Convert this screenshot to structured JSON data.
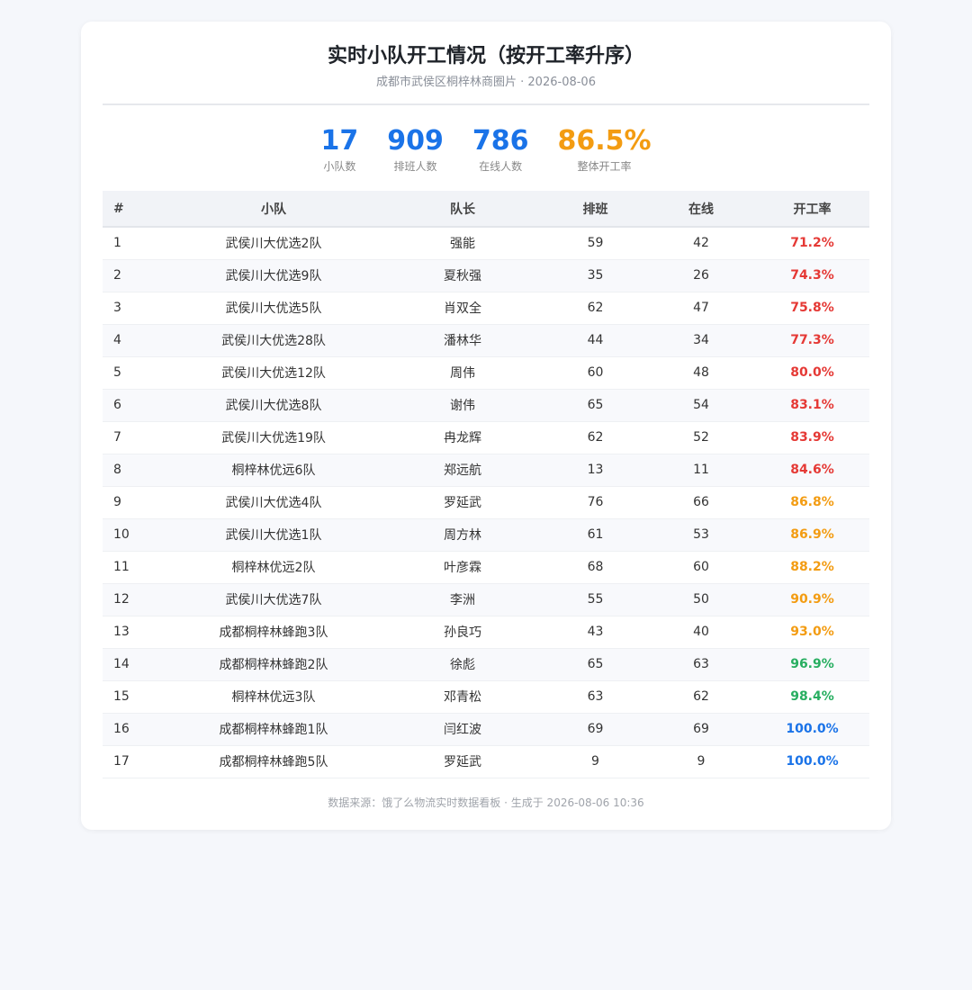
{
  "header": {
    "title": "实时小队开工情况（按开工率升序）",
    "subtitle": "成都市武侯区桐梓林商圈片 · 2026-08-06"
  },
  "stats": [
    {
      "value": "17",
      "label": "小队数",
      "color": "#1a73e8"
    },
    {
      "value": "909",
      "label": "排班人数",
      "color": "#1a73e8"
    },
    {
      "value": "786",
      "label": "在线人数",
      "color": "#1a73e8"
    },
    {
      "value": "86.5%",
      "label": "整体开工率",
      "color": "#f39c12"
    }
  ],
  "table": {
    "columns": [
      "#",
      "小队",
      "队长",
      "排班",
      "在线",
      "开工率"
    ],
    "rows": [
      [
        "1",
        "武侯川大优选2队",
        "强能",
        "59",
        "42",
        "71.2%"
      ],
      [
        "2",
        "武侯川大优选9队",
        "夏秋强",
        "35",
        "26",
        "74.3%"
      ],
      [
        "3",
        "武侯川大优选5队",
        "肖双全",
        "62",
        "47",
        "75.8%"
      ],
      [
        "4",
        "武侯川大优选28队",
        "潘林华",
        "44",
        "34",
        "77.3%"
      ],
      [
        "5",
        "武侯川大优选12队",
        "周伟",
        "60",
        "48",
        "80.0%"
      ],
      [
        "6",
        "武侯川大优选8队",
        "谢伟",
        "65",
        "54",
        "83.1%"
      ],
      [
        "7",
        "武侯川大优选19队",
        "冉龙辉",
        "62",
        "52",
        "83.9%"
      ],
      [
        "8",
        "桐梓林优远6队",
        "郑远航",
        "13",
        "11",
        "84.6%"
      ],
      [
        "9",
        "武侯川大优选4队",
        "罗延武",
        "76",
        "66",
        "86.8%"
      ],
      [
        "10",
        "武侯川大优选1队",
        "周方林",
        "61",
        "53",
        "86.9%"
      ],
      [
        "11",
        "桐梓林优远2队",
        "叶彦霖",
        "68",
        "60",
        "88.2%"
      ],
      [
        "12",
        "武侯川大优选7队",
        "李洲",
        "55",
        "50",
        "90.9%"
      ],
      [
        "13",
        "成都桐梓林蜂跑3队",
        "孙良巧",
        "43",
        "40",
        "93.0%"
      ],
      [
        "14",
        "成都桐梓林蜂跑2队",
        "徐彪",
        "65",
        "63",
        "96.9%"
      ],
      [
        "15",
        "桐梓林优远3队",
        "邓青松",
        "63",
        "62",
        "98.4%"
      ],
      [
        "16",
        "成都桐梓林蜂跑1队",
        "闫红波",
        "69",
        "69",
        "100.0%"
      ],
      [
        "17",
        "成都桐梓林蜂跑5队",
        "罗延武",
        "9",
        "9",
        "100.0%"
      ]
    ],
    "rate_colors": {
      "low": "#e53935",
      "mid": "#f39c12",
      "high": "#27ae60",
      "full": "#1a73e8"
    }
  },
  "footer": {
    "text": "数据来源：饿了么物流实时数据看板 · 生成于 2026-08-06 10:36"
  }
}
